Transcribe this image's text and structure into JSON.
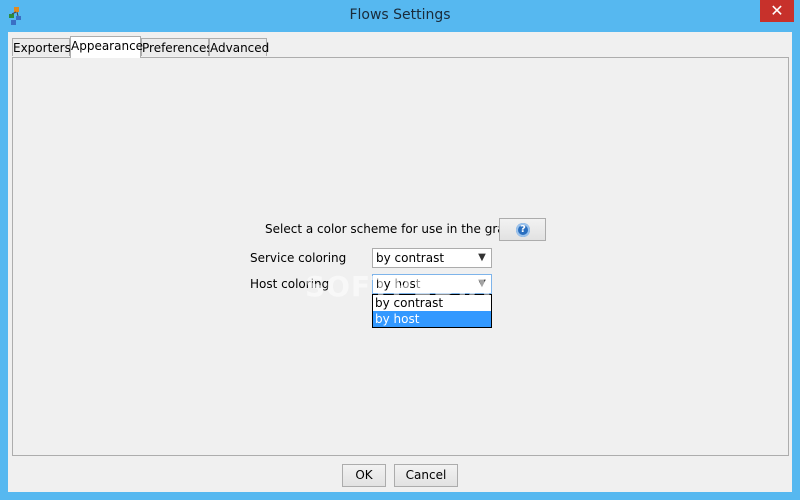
{
  "window": {
    "title": "Flows Settings",
    "close_glyph": "✕"
  },
  "tabs": [
    {
      "label": "Exporters"
    },
    {
      "label": "Appearance"
    },
    {
      "label": "Preferences"
    },
    {
      "label": "Advanced"
    }
  ],
  "appearance": {
    "color_scheme_label": "Select a color scheme for use in the graphs:",
    "help_icon": "?",
    "service_coloring": {
      "label": "Service coloring",
      "value": "by contrast"
    },
    "host_coloring": {
      "label": "Host coloring",
      "value": "by host",
      "options": [
        "by contrast",
        "by host"
      ]
    }
  },
  "watermark": "SOFTPEDIA",
  "buttons": {
    "ok": "OK",
    "cancel": "Cancel"
  },
  "colors": {
    "selection": "#3399ff",
    "close": "#c7312b",
    "frame": "#56b8f0"
  }
}
